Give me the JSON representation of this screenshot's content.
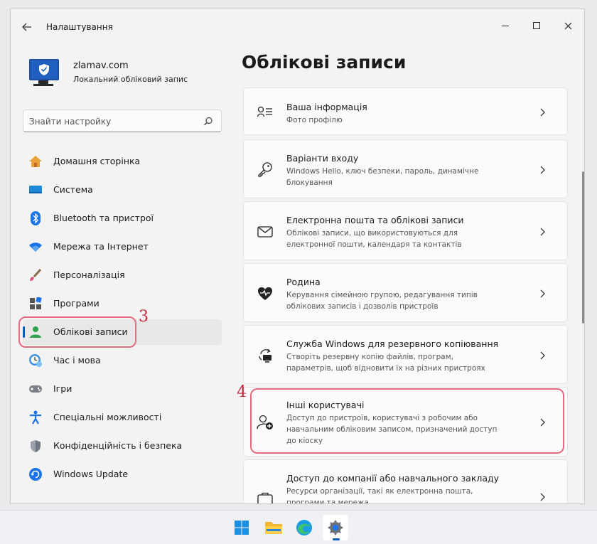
{
  "window": {
    "title": "Налаштування"
  },
  "profile": {
    "name": "zlamav.com",
    "type": "Локальний обліковий запис"
  },
  "search": {
    "placeholder": "Знайти настройку"
  },
  "nav": {
    "items": [
      {
        "label": "Домашня сторінка",
        "icon": "home-icon"
      },
      {
        "label": "Система",
        "icon": "system-icon"
      },
      {
        "label": "Bluetooth та пристрої",
        "icon": "bluetooth-icon"
      },
      {
        "label": "Мережа та Інтернет",
        "icon": "wifi-icon"
      },
      {
        "label": "Персоналізація",
        "icon": "brush-icon"
      },
      {
        "label": "Програми",
        "icon": "apps-icon"
      },
      {
        "label": "Облікові записи",
        "icon": "accounts-icon",
        "selected": true
      },
      {
        "label": "Час і мова",
        "icon": "time-language-icon"
      },
      {
        "label": "Ігри",
        "icon": "gaming-icon"
      },
      {
        "label": "Спеціальні можливості",
        "icon": "accessibility-icon"
      },
      {
        "label": "Конфіденційність і безпека",
        "icon": "shield-icon"
      },
      {
        "label": "Windows Update",
        "icon": "windows-update-icon"
      }
    ]
  },
  "main": {
    "title": "Облікові записи",
    "cards": [
      {
        "title": "Ваша інформація",
        "desc": "Фото профілю",
        "icon": "user-info-icon"
      },
      {
        "title": "Варіанти входу",
        "desc": "Windows Hello, ключ безпеки, пароль, динамічне блокування",
        "icon": "key-icon"
      },
      {
        "title": "Електронна пошта та облікові записи",
        "desc": "Облікові записи, що використовуються для електронної пошти, календаря та контактів",
        "icon": "mail-icon"
      },
      {
        "title": "Родина",
        "desc": "Керування сімейною групою, редагування типів облікових записів і дозволів пристроїв",
        "icon": "family-icon"
      },
      {
        "title": "Служба Windows для резервного копіювання",
        "desc": "Створіть резервну копію файлів, програм, параметрів, щоб відновити їх на різних пристроях",
        "icon": "backup-icon"
      },
      {
        "title": "Інші користувачі",
        "desc": "Доступ до пристроїв, користувачі з робочим або навчальним обліковим записом, призначений доступ до кіоску",
        "icon": "add-user-icon"
      },
      {
        "title": "Доступ до компанії або навчального закладу",
        "desc": "Ресурси організації, такі як електронна пошта, програми та мережа",
        "icon": "briefcase-icon"
      }
    ]
  },
  "annotations": {
    "nav_marker": "3",
    "card_marker": "4"
  },
  "taskbar": {
    "items": [
      {
        "icon": "windows-start-icon"
      },
      {
        "icon": "file-explorer-icon"
      },
      {
        "icon": "edge-browser-icon"
      },
      {
        "icon": "settings-gear-icon",
        "active": true
      }
    ]
  },
  "colors": {
    "accent": "#005fb8",
    "annotation": "#e46b7e"
  }
}
